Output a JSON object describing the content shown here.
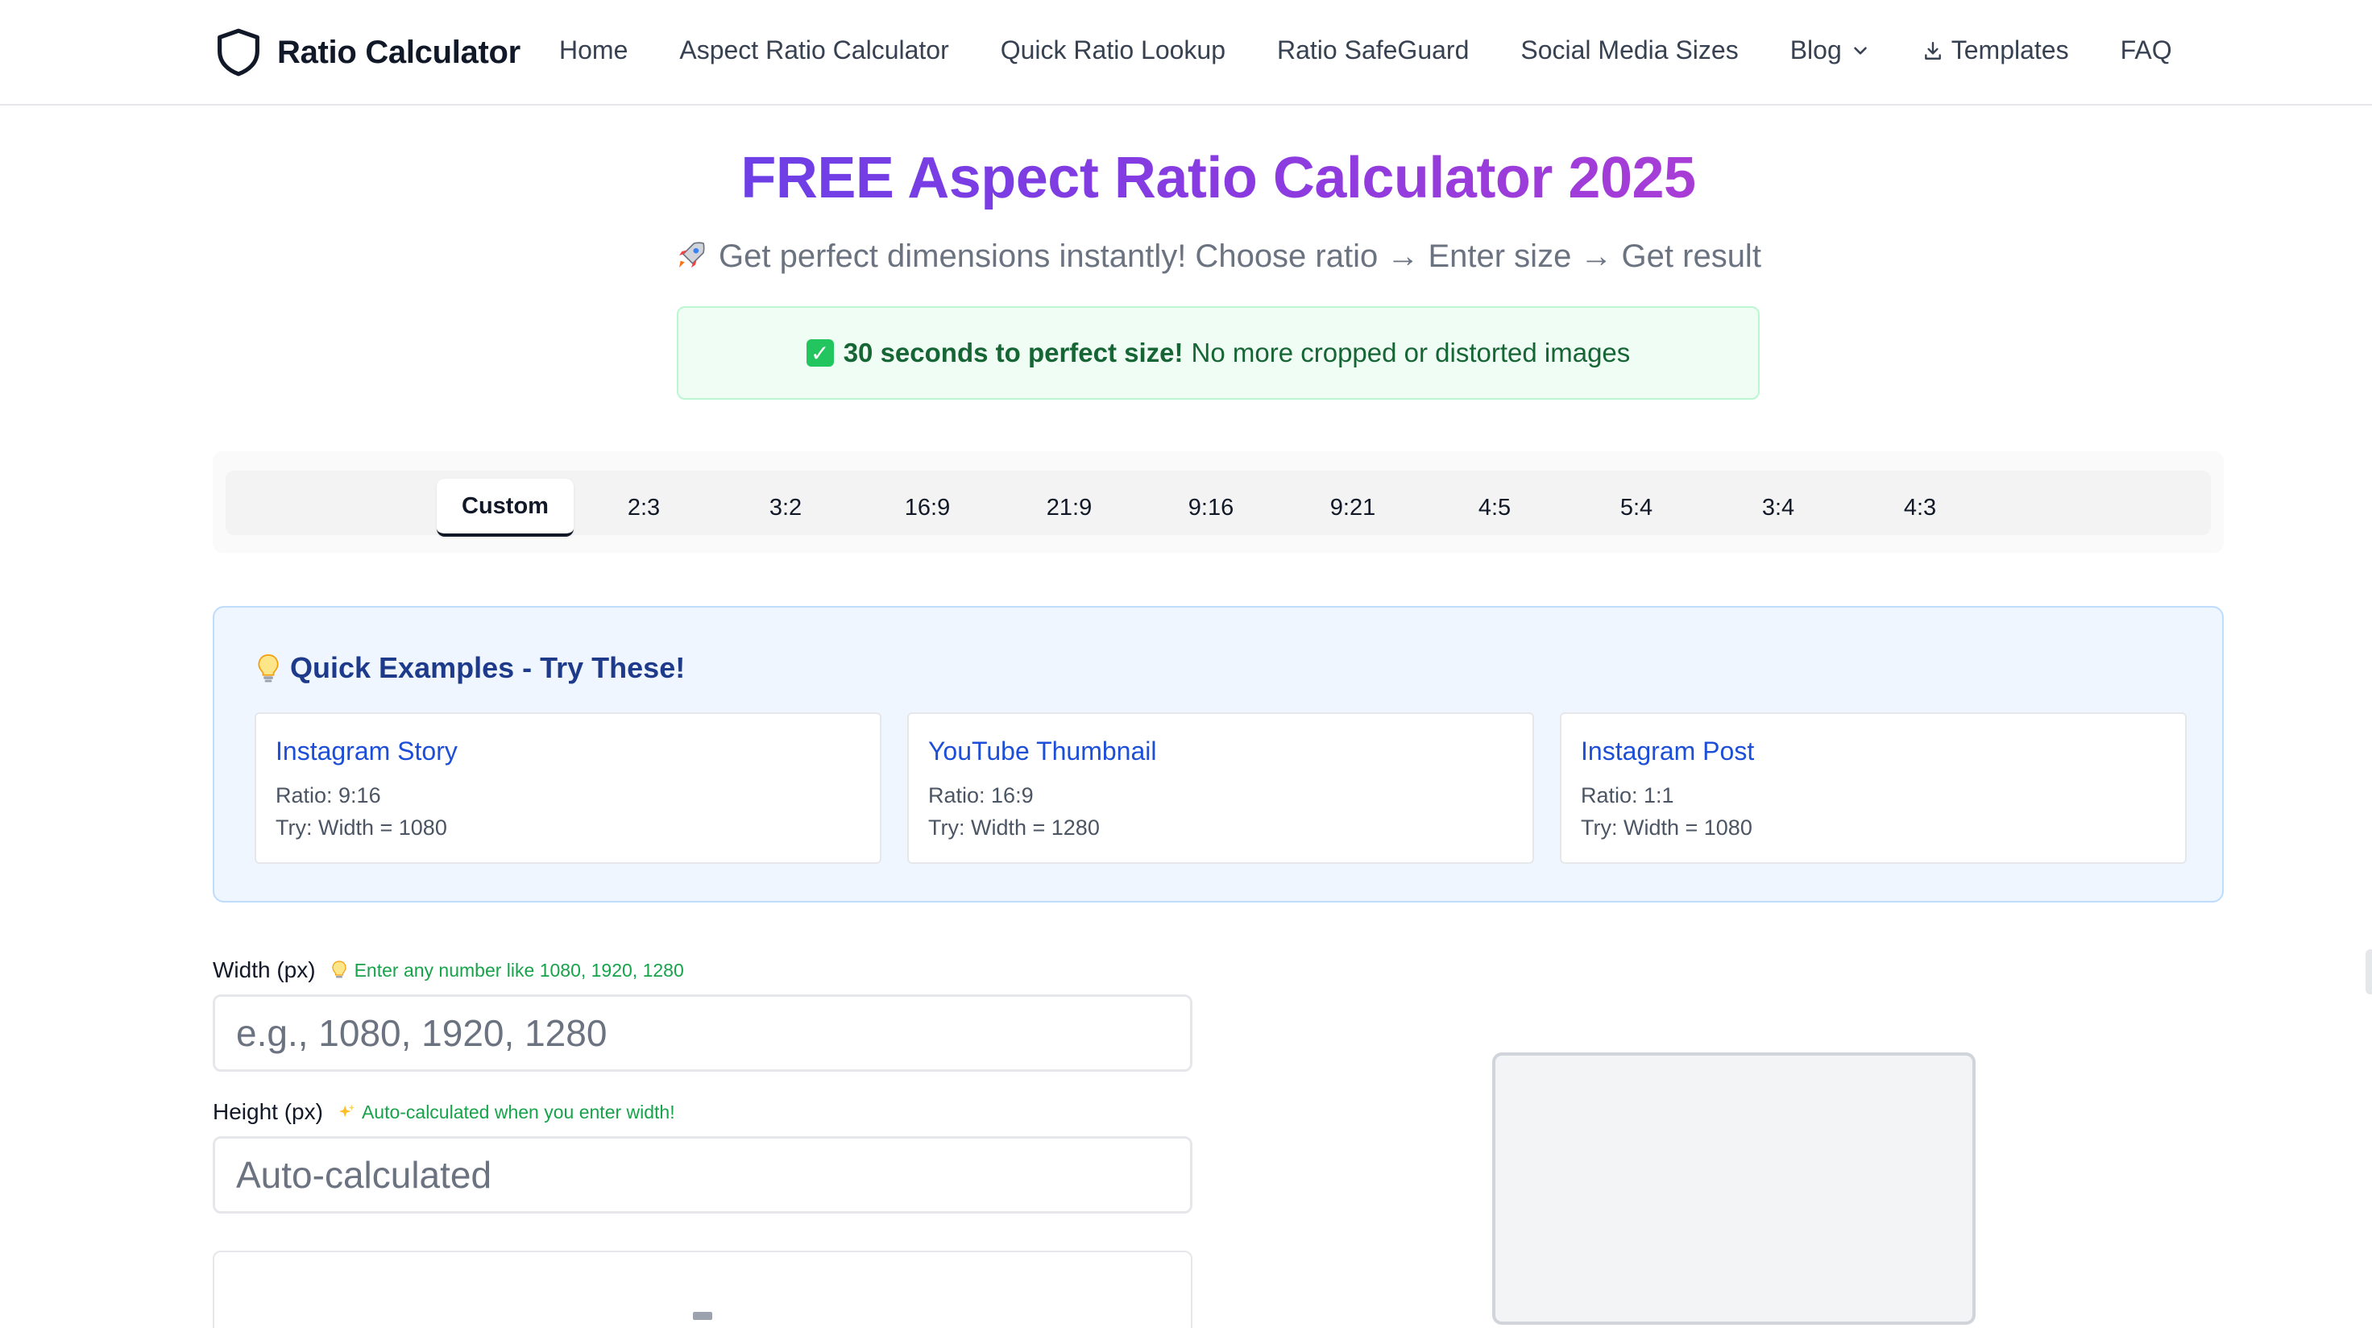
{
  "nav": {
    "brand": "Ratio Calculator",
    "links": [
      "Home",
      "Aspect Ratio Calculator",
      "Quick Ratio Lookup",
      "Ratio SafeGuard",
      "Social Media Sizes",
      "Blog",
      "Templates",
      "FAQ"
    ]
  },
  "hero": {
    "title": "FREE Aspect Ratio Calculator 2025",
    "subtitle": "Get perfect dimensions instantly! Choose ratio → Enter size → Get result",
    "notice_bold": "30 seconds to perfect size!",
    "notice_rest": "No more cropped or distorted images"
  },
  "tabs": [
    "Custom",
    "2:3",
    "3:2",
    "16:9",
    "21:9",
    "9:16",
    "9:21",
    "4:5",
    "5:4",
    "3:4",
    "4:3"
  ],
  "active_tab": "Custom",
  "quick_examples": {
    "title": "Quick Examples - Try These!",
    "cards": [
      {
        "title": "Instagram Story",
        "ratio": "Ratio: 9:16",
        "try": "Try: Width = 1080"
      },
      {
        "title": "YouTube Thumbnail",
        "ratio": "Ratio: 16:9",
        "try": "Try: Width = 1280"
      },
      {
        "title": "Instagram Post",
        "ratio": "Ratio: 1:1",
        "try": "Try: Width = 1080"
      }
    ]
  },
  "form": {
    "width_label": "Width (px)",
    "width_hint": "Enter any number like 1080, 1920, 1280",
    "width_placeholder": "e.g., 1080, 1920, 1280",
    "height_label": "Height (px)",
    "height_hint": "Auto-calculated when you enter width!",
    "height_placeholder": "Auto-calculated"
  },
  "colors": {
    "brand_gradient_start": "#6d3fe6",
    "brand_gradient_end": "#a83dd6",
    "notice_text": "#166534",
    "examples_title": "#1e3a8a",
    "card_title": "#1d4ed8",
    "hint": "#16a34a"
  },
  "icons": {
    "brand": "shield-icon",
    "blog": "chevron-down-icon",
    "templates": "download-icon",
    "subtitle": "rocket-icon",
    "notice": "check-icon",
    "examples": "lightbulb-icon",
    "width_hint": "lightbulb-icon",
    "height_hint": "sparkles-icon"
  }
}
